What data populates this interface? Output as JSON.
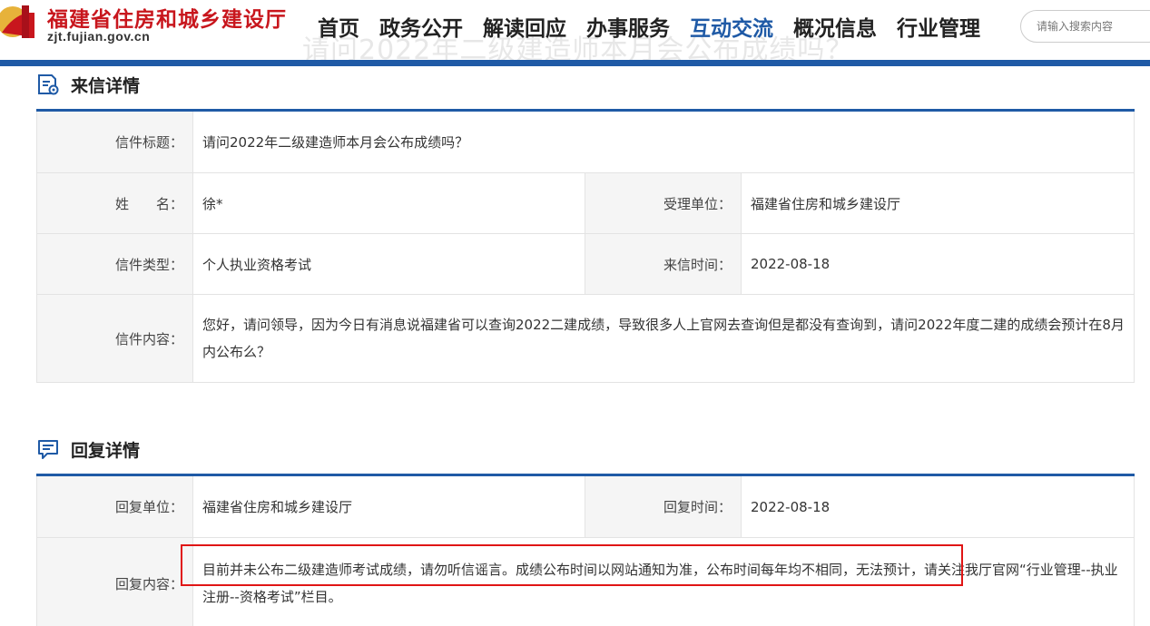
{
  "header": {
    "site_title": "福建省住房和城乡建设厅",
    "site_url": "zjt.fujian.gov.cn",
    "watermark_title": "请问2022年二级建造师本月会公布成绩吗？",
    "nav": [
      {
        "label": "首页"
      },
      {
        "label": "政务公开"
      },
      {
        "label": "解读回应"
      },
      {
        "label": "办事服务"
      },
      {
        "label": "互动交流",
        "active": true
      },
      {
        "label": "概况信息"
      },
      {
        "label": "行业管理"
      }
    ],
    "search_placeholder": "请输入搜索内容"
  },
  "letter": {
    "section_title": "来信详情",
    "title_label": "信件标题：",
    "title_value": "请问2022年二级建造师本月会公布成绩吗？",
    "name_label": "姓　　名：",
    "name_value": "徐*",
    "dept_label": "受理单位：",
    "dept_value": "福建省住房和城乡建设厅",
    "type_label": "信件类型：",
    "type_value": "个人执业资格考试",
    "time_label": "来信时间：",
    "time_value": "2022-08-18",
    "content_label": "信件内容：",
    "content_value": "您好，请问领导，因为今日有消息说福建省可以查询2022二建成绩，导致很多人上官网去查询但是都没有查询到，请问2022年度二建的成绩会预计在8月内公布么？"
  },
  "reply": {
    "section_title": "回复详情",
    "unit_label": "回复单位：",
    "unit_value": "福建省住房和城乡建设厅",
    "time_label": "回复时间：",
    "time_value": "2022-08-18",
    "content_label": "回复内容：",
    "content_value": "目前并未公布二级建造师考试成绩，请勿听信谣言。成绩公布时间以网站通知为准，公布时间每年均不相同，无法预计，请关注我厅官网“行业管理--执业注册--资格考试”栏目。"
  },
  "colors": {
    "brand_blue": "#1f5aa6",
    "logo_red": "#c8161d",
    "highlight_red": "#e01515"
  }
}
